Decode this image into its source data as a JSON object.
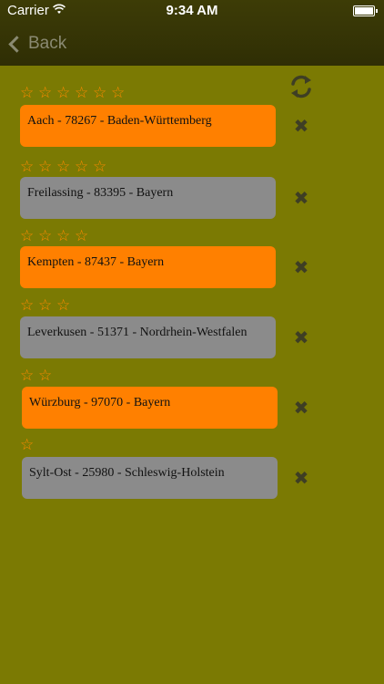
{
  "status_bar": {
    "carrier": "Carrier",
    "time": "9:34 AM"
  },
  "nav": {
    "back_label": "Back"
  },
  "colors": {
    "orange": "#ff8000",
    "gray": "#8b8b8b",
    "background": "#7b7a03",
    "star": "#ff8a00"
  },
  "entries": [
    {
      "stars": 6,
      "label": "Aach - 78267 - Baden-Württemberg",
      "color": "orange"
    },
    {
      "stars": 5,
      "label": "Freilassing - 83395 - Bayern",
      "color": "gray"
    },
    {
      "stars": 4,
      "label": "Kempten - 87437 - Bayern",
      "color": "orange"
    },
    {
      "stars": 3,
      "label": "Leverkusen - 51371 - Nordrhein-Westfalen",
      "color": "gray"
    },
    {
      "stars": 2,
      "label": "Würzburg - 97070 - Bayern",
      "color": "orange"
    },
    {
      "stars": 1,
      "label": "Sylt-Ost - 25980 - Schleswig-Holstein",
      "color": "gray"
    }
  ]
}
